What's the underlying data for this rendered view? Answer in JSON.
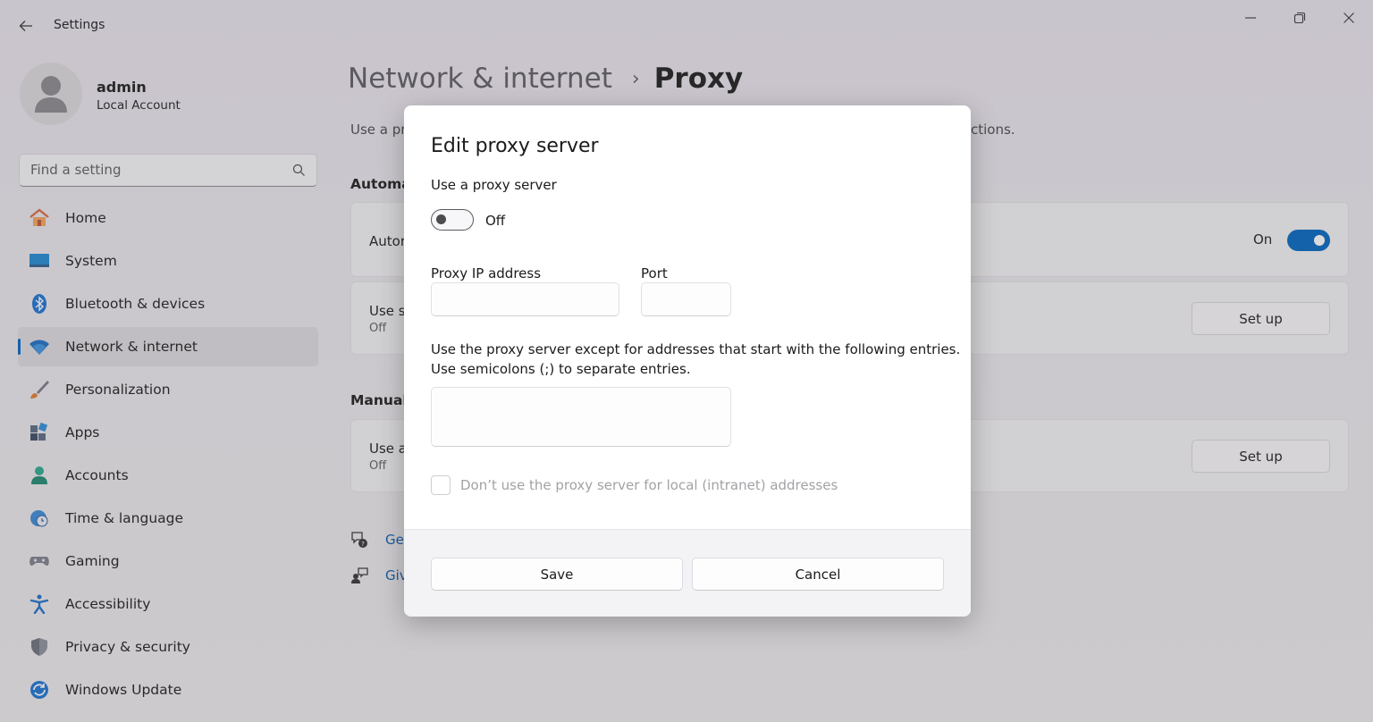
{
  "window": {
    "title": "Settings",
    "back_icon": "arrow-left-icon",
    "controls": [
      "minimize-icon",
      "restore-icon",
      "close-icon"
    ]
  },
  "profile": {
    "name": "admin",
    "account_type": "Local Account"
  },
  "search": {
    "placeholder": "Find a setting"
  },
  "sidebar": {
    "items": [
      {
        "label": "Home",
        "icon": "home-icon"
      },
      {
        "label": "System",
        "icon": "system-icon"
      },
      {
        "label": "Bluetooth & devices",
        "icon": "bluetooth-icon"
      },
      {
        "label": "Network & internet",
        "icon": "wifi-icon",
        "selected": true
      },
      {
        "label": "Personalization",
        "icon": "brush-icon"
      },
      {
        "label": "Apps",
        "icon": "apps-icon"
      },
      {
        "label": "Accounts",
        "icon": "accounts-icon"
      },
      {
        "label": "Time & language",
        "icon": "clock-globe-icon"
      },
      {
        "label": "Gaming",
        "icon": "gamepad-icon"
      },
      {
        "label": "Accessibility",
        "icon": "accessibility-icon"
      },
      {
        "label": "Privacy & security",
        "icon": "shield-icon"
      },
      {
        "label": "Windows Update",
        "icon": "update-icon"
      }
    ]
  },
  "main": {
    "breadcrumb_parent": "Network & internet",
    "breadcrumb_sep": "›",
    "page_title": "Proxy",
    "description_start": "Use a pr",
    "description_end": "ctions.",
    "automatic_section": "Automa",
    "auto_detect_card": {
      "title": "Autor",
      "toggle_label": "On"
    },
    "setup_script_card": {
      "title": "Use s",
      "status": "Off",
      "button": "Set up"
    },
    "manual_section": "Manual",
    "manual_card": {
      "title": "Use a",
      "status": "Off",
      "button": "Set up"
    },
    "links": [
      {
        "label": "Ge",
        "icon": "help-icon"
      },
      {
        "label": "Giv",
        "icon": "feedback-icon"
      }
    ]
  },
  "dialog": {
    "title": "Edit proxy server",
    "use_proxy_label": "Use a proxy server",
    "toggle_state": "Off",
    "ip_label": "Proxy IP address",
    "ip_value": "",
    "port_label": "Port",
    "port_value": "",
    "exceptions_line1": "Use the proxy server except for addresses that start with the following entries.",
    "exceptions_line2": "Use semicolons (;) to separate entries.",
    "exceptions_value": "",
    "local_checkbox_label": "Don’t use the proxy server for local (intranet) addresses",
    "save": "Save",
    "cancel": "Cancel"
  },
  "colors": {
    "accent": "#0067c0",
    "link": "#0b5cad"
  }
}
